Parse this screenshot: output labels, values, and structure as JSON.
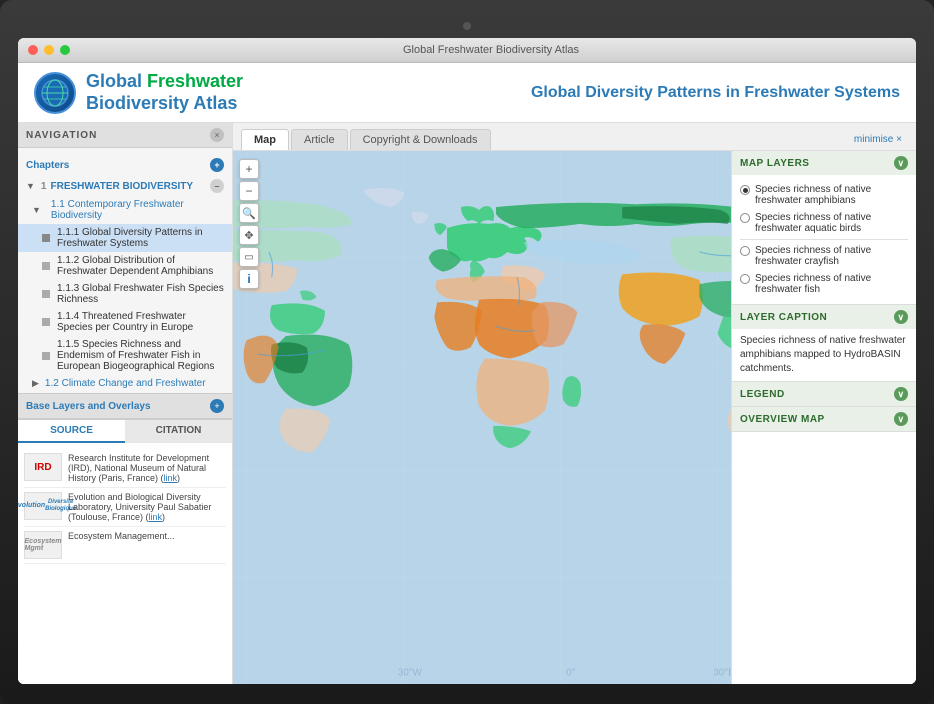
{
  "browser": {
    "title": "Global Freshwater Biodiversity Atlas"
  },
  "header": {
    "logo_line1_prefix": "Global ",
    "logo_line1_highlight": "Freshwater",
    "logo_line2": "Biodiversity Atlas",
    "page_title": "Global Diversity Patterns in Freshwater Systems"
  },
  "navigation": {
    "label": "NAVIGATION",
    "chapters_label": "Chapters",
    "items": [
      {
        "id": "1",
        "level": 1,
        "num": "1",
        "label": "FRESHWATER BIODIVERSITY",
        "expanded": true
      },
      {
        "id": "1.1",
        "level": 2,
        "num": "1.1",
        "label": "Contemporary Freshwater Biodiversity",
        "expanded": true
      },
      {
        "id": "1.1.1",
        "level": 3,
        "num": "1.1.1",
        "label": "Global Diversity Patterns in Freshwater Systems",
        "selected": true
      },
      {
        "id": "1.1.2",
        "level": 3,
        "num": "1.1.2",
        "label": "Global Distribution of Freshwater Dependent Amphibians"
      },
      {
        "id": "1.1.3",
        "level": 3,
        "num": "1.1.3",
        "label": "Global Freshwater Fish Species Richness"
      },
      {
        "id": "1.1.4",
        "level": 3,
        "num": "1.1.4",
        "label": "Threatened Freshwater Species per Country in Europe"
      },
      {
        "id": "1.1.5",
        "level": 3,
        "num": "1.1.5",
        "label": "Species Richness and Endemism of Freshwater Fish in European Biogeographical Regions"
      },
      {
        "id": "1.2",
        "level": 2,
        "num": "1.2",
        "label": "Climate Change and Freshwater"
      }
    ],
    "base_layers_label": "Base Layers and Overlays"
  },
  "source_tabs": [
    {
      "id": "source",
      "label": "SOURCE",
      "active": true
    },
    {
      "id": "citation",
      "label": "CITATION",
      "active": false
    }
  ],
  "sources": [
    {
      "logo": "IRD",
      "logo_type": "ird",
      "text": "Research Institute for Development (IRD), National Museum of Natural History (Paris, France)",
      "link_text": "link"
    },
    {
      "logo": "ɛvolution\nDiversité Biologique",
      "logo_type": "evol",
      "text": "Evolution and Biological Diversity Laboratory, University Paul Sabatier (Toulouse, France)",
      "link_text": "link"
    },
    {
      "logo": "Ecosystem",
      "logo_type": "eco",
      "text": "Ecosystem Management...",
      "link_text": ""
    }
  ],
  "map_tabs": [
    {
      "id": "map",
      "label": "Map",
      "active": true
    },
    {
      "id": "article",
      "label": "Article",
      "active": false
    },
    {
      "id": "copyright",
      "label": "Copyright & Downloads",
      "active": false
    }
  ],
  "minimise_label": "minimise",
  "map_controls": [
    {
      "id": "zoom-in",
      "symbol": "+"
    },
    {
      "id": "zoom-out",
      "symbol": "−"
    },
    {
      "id": "search",
      "symbol": "⌕"
    },
    {
      "id": "pan",
      "symbol": "✥"
    },
    {
      "id": "select",
      "symbol": "▭"
    },
    {
      "id": "info",
      "symbol": "i"
    }
  ],
  "map_layers": {
    "section_label": "MAP LAYERS",
    "items": [
      {
        "id": "amphibians",
        "label": "Species richness of native freshwater amphibians",
        "checked": true
      },
      {
        "id": "birds",
        "label": "Species richness of native freshwater aquatic birds",
        "checked": false
      },
      {
        "id": "crayfish",
        "label": "Species richness of native freshwater crayfish",
        "checked": false
      },
      {
        "id": "fish",
        "label": "Species richness of native freshwater fish",
        "checked": false
      }
    ]
  },
  "layer_caption": {
    "section_label": "LAYER CAPTION",
    "text": "Species richness of native freshwater amphibians mapped to HydroBASIN catchments."
  },
  "legend": {
    "section_label": "LEGEND"
  },
  "overview_map": {
    "section_label": "OVERVIEW MAP"
  }
}
